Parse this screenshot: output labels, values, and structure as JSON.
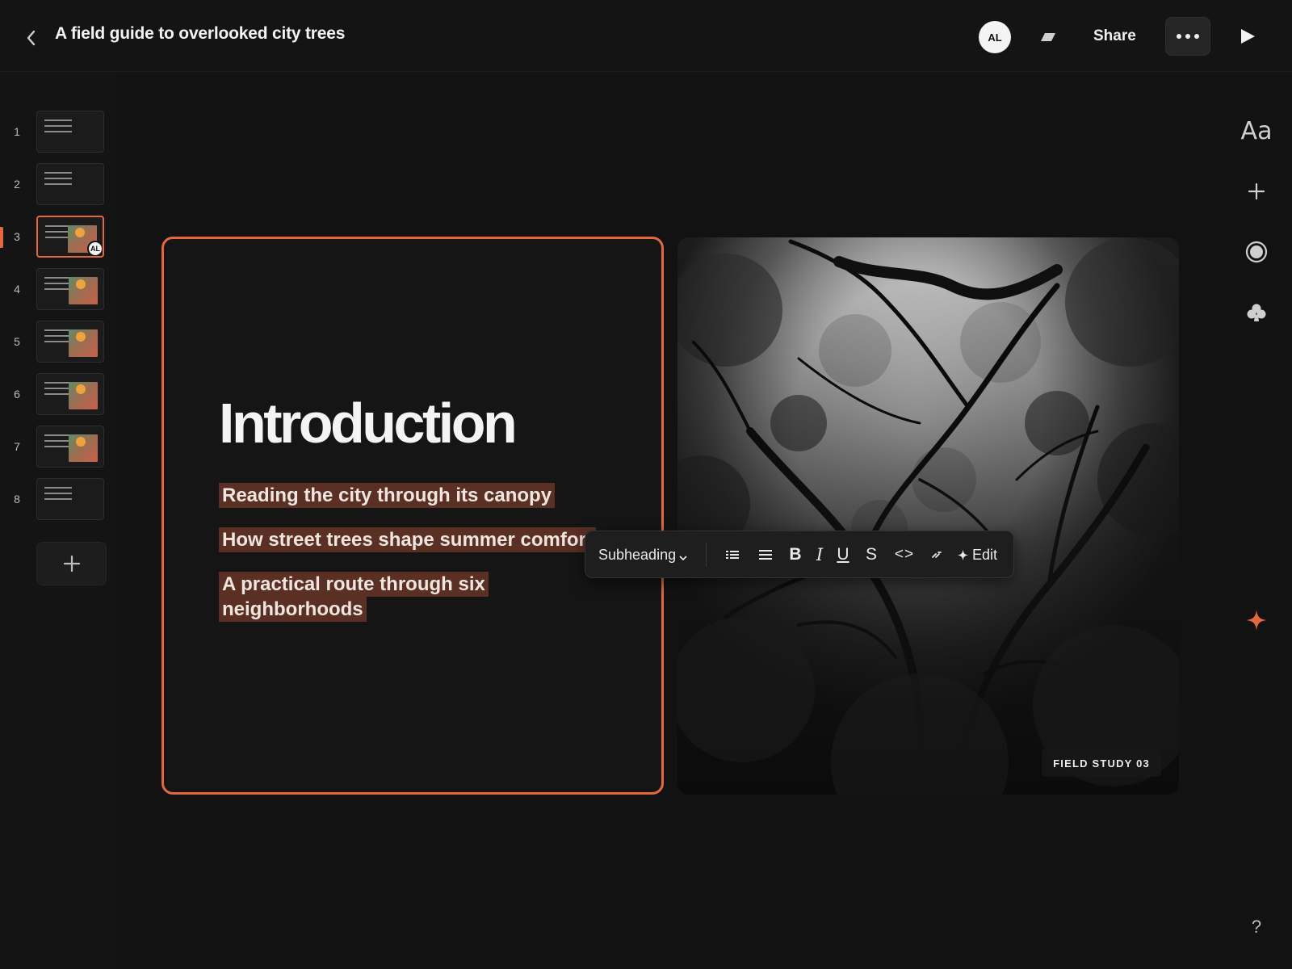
{
  "header": {
    "title": "A field guide to overlooked city trees",
    "avatar_initials": "AL",
    "share_label": "Share"
  },
  "sidebar": {
    "slides": [
      {
        "number": "1",
        "has_image": false,
        "active": false
      },
      {
        "number": "2",
        "has_image": false,
        "active": false
      },
      {
        "number": "3",
        "has_image": true,
        "active": true,
        "collaborator": "AL"
      },
      {
        "number": "4",
        "has_image": true,
        "active": false
      },
      {
        "number": "5",
        "has_image": true,
        "active": false
      },
      {
        "number": "6",
        "has_image": true,
        "active": false
      },
      {
        "number": "7",
        "has_image": true,
        "active": false
      },
      {
        "number": "8",
        "has_image": false,
        "active": false
      }
    ],
    "add_slide_icon": "plus-icon"
  },
  "slide": {
    "title": "Introduction",
    "bullets": [
      "Reading the city through its canopy",
      "How street trees shape summer comfort",
      "A practical route through six neighborhoods"
    ],
    "photo_caption": "FIELD STUDY 03"
  },
  "toolbar": {
    "style_label": "Subheading",
    "edit_label": "Edit"
  },
  "right_rail": {
    "font_label": "Aa",
    "help_label": "?"
  },
  "colors": {
    "accent": "#e4683f",
    "highlight": "#5a2f24",
    "background": "#121212"
  }
}
